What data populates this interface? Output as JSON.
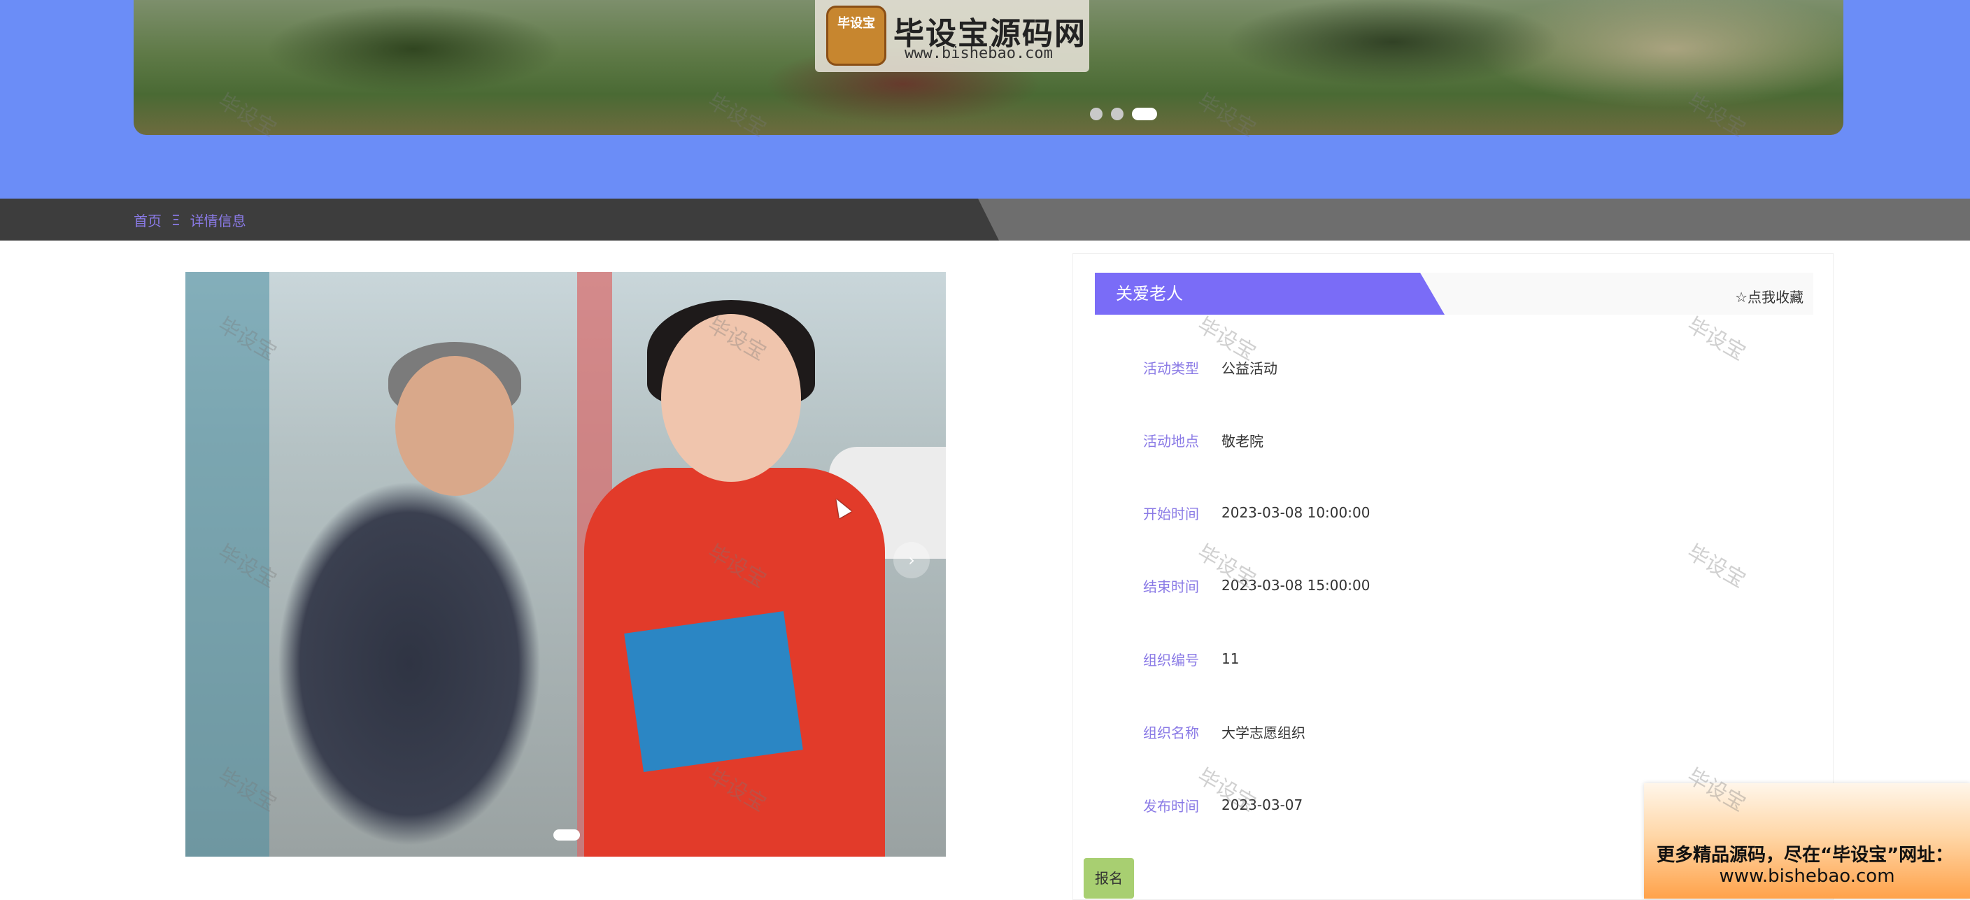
{
  "banner": {
    "logo_mark_text": "毕设宝",
    "logo_title": "毕设宝源码网",
    "logo_url": "www.bishebao.com",
    "slide_count": 3,
    "active_slide": 3
  },
  "breadcrumb": {
    "home": "首页",
    "separator": "Ξ",
    "current": "详情信息"
  },
  "photo": {
    "next_arrow": "›",
    "slide_count": 1
  },
  "detail": {
    "title": "关爱老人",
    "favorite_label": "☆点我收藏",
    "fields": [
      {
        "label": "活动类型",
        "value": "公益活动"
      },
      {
        "label": "活动地点",
        "value": "敬老院"
      },
      {
        "label": "开始时间",
        "value": "2023-03-08 10:00:00"
      },
      {
        "label": "结束时间",
        "value": "2023-03-08 15:00:00"
      },
      {
        "label": "组织编号",
        "value": "11"
      },
      {
        "label": "组织名称",
        "value": "大学志愿组织"
      },
      {
        "label": "发布时间",
        "value": "2023-03-07"
      }
    ],
    "signup_label": "报名"
  },
  "ad": {
    "line1": "更多精品源码，尽在“毕设宝”网址：",
    "line2": "www.bishebao.com"
  },
  "watermark": "毕设宝",
  "colors": {
    "top_band": "#6b8df7",
    "accent": "#7a6cf7",
    "crumb_bar": "#3d3d3d",
    "signup": "#a8cf71"
  }
}
